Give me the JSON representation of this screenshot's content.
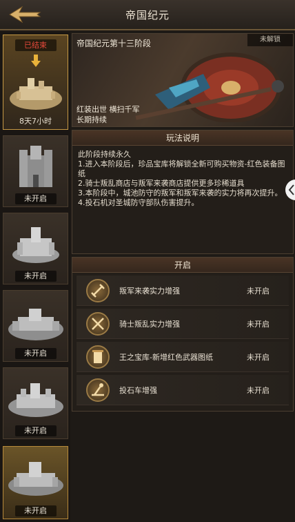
{
  "header": {
    "title": "帝国纪元"
  },
  "sidebar": {
    "stages": [
      {
        "ended_label": "已结束",
        "time_label": "8天7小时"
      },
      {
        "status": "未开启"
      },
      {
        "status": "未开启"
      },
      {
        "status": "未开启"
      },
      {
        "status": "未开启"
      },
      {
        "status": "未开启"
      }
    ]
  },
  "banner": {
    "title": "帝国纪元第十三阶段",
    "badge": "未解锁",
    "desc_line1": "红装出世  横扫千军",
    "desc_line2": "长期持续"
  },
  "rules": {
    "title": "玩法说明",
    "lines": [
      "此阶段持续永久",
      "1.进入本阶段后，珍品宝库将解锁全新可购买物资-红色装备图纸",
      "2.骑士叛乱商店与叛军来袭商店提供更多珍稀道具",
      "3.本阶段中，城池防守的叛军和叛军来袭的实力将再次提升。",
      "4.投石机对圣城防守部队伤害提升。"
    ]
  },
  "unlocks": {
    "title": "开启",
    "items": [
      {
        "name": "叛军来袭实力增强",
        "status": "未开启",
        "icon": "rebel-axe-icon"
      },
      {
        "name": "骑士叛乱实力增强",
        "status": "未开启",
        "icon": "crossed-swords-icon"
      },
      {
        "name": "王之宝库-新增红色武器图纸",
        "status": "未开启",
        "icon": "scroll-icon"
      },
      {
        "name": "投石车增强",
        "status": "未开启",
        "icon": "catapult-icon"
      }
    ]
  },
  "colors": {
    "accent": "#c79a45",
    "ended": "#e5483a"
  }
}
